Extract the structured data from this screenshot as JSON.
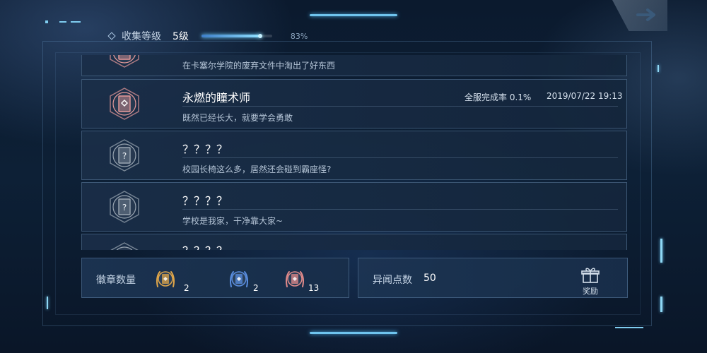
{
  "header": {
    "label": "收集等级",
    "level": "5级",
    "progress": 0.83,
    "percent_text": "83%"
  },
  "achievements": [
    {
      "title": "",
      "desc": "在卡塞尔学院的废弃文件中淘出了好东西",
      "state": "unlocked",
      "rate": "",
      "date": ""
    },
    {
      "title": "永燃的瞳术师",
      "desc": "既然已经长大，就要学会勇敢",
      "state": "unlocked",
      "rate": "全服完成率 0.1%",
      "date": "2019/07/22 19:13"
    },
    {
      "title": "？？？？",
      "desc": "校园长椅这么多，居然还会碰到霸座怪?",
      "state": "locked",
      "rate": "",
      "date": ""
    },
    {
      "title": "？？？？",
      "desc": "学校是我家，干净靠大家~",
      "state": "locked",
      "rate": "",
      "date": ""
    },
    {
      "title": "？？？？",
      "desc": "",
      "state": "locked",
      "rate": "",
      "date": ""
    }
  ],
  "badges": {
    "label": "徽章数量",
    "items": [
      {
        "icon": "gold-badge-icon",
        "count": "2",
        "color": "#e0a64a"
      },
      {
        "icon": "blue-badge-icon",
        "count": "2",
        "color": "#5a8ee0"
      },
      {
        "icon": "pink-badge-icon",
        "count": "13",
        "color": "#e08a8a"
      }
    ]
  },
  "points": {
    "label": "异闻点数",
    "value": "50",
    "reward_label": "奖励"
  },
  "colors": {
    "accent": "#6fc4ee",
    "unlocked_badge": "#e79a9a",
    "locked_badge": "#9aa6b2"
  }
}
